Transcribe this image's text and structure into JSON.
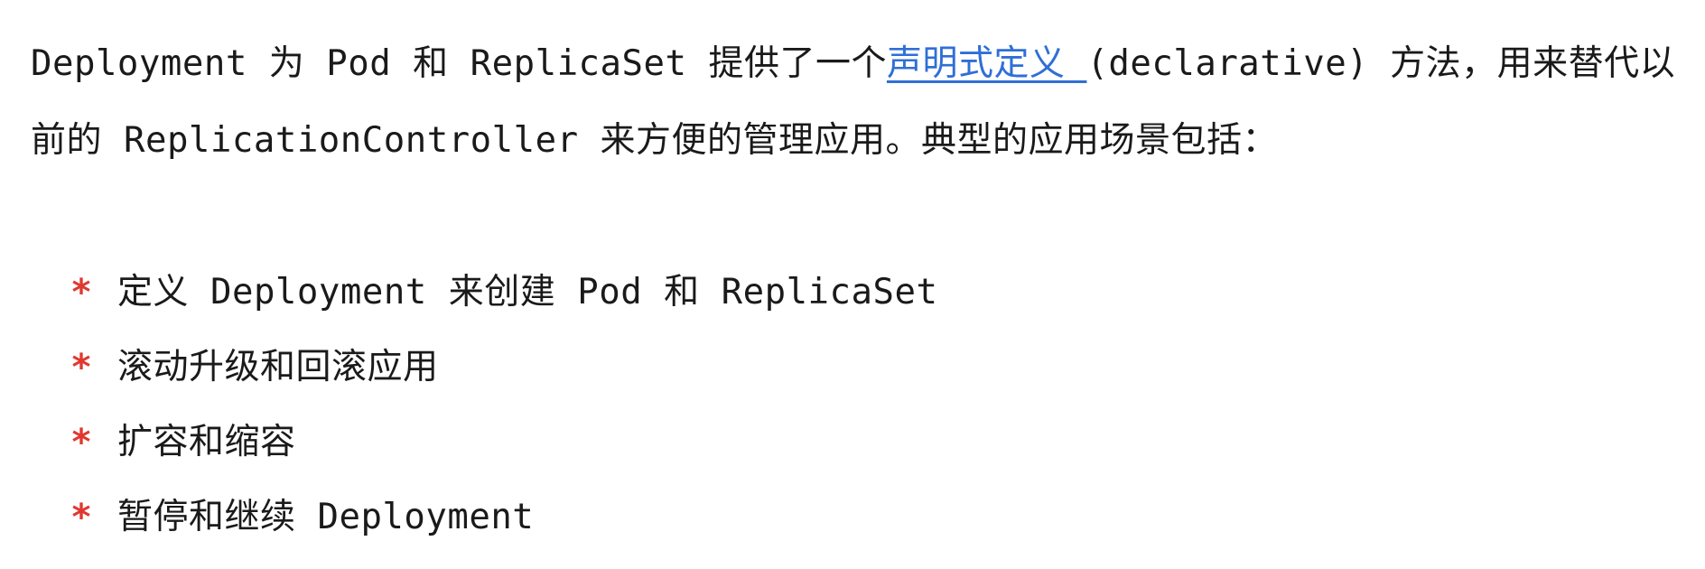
{
  "intro": {
    "part1": "Deployment 为 Pod 和 ReplicaSet 提供了一个",
    "link_text": "声明式定义 ",
    "part2": "(declarative) 方法，用来替代以前的 ReplicationController 来方便的管理应用。典型的应用场景包括："
  },
  "bullet_symbol": "*",
  "use_cases": [
    "定义 Deployment 来创建 Pod 和 ReplicaSet",
    "滚动升级和回滚应用",
    "扩容和缩容",
    "暂停和继续 Deployment"
  ],
  "colors": {
    "link": "#2f6fd6",
    "bullet": "#e0382f",
    "text": "#1a1a1a"
  }
}
